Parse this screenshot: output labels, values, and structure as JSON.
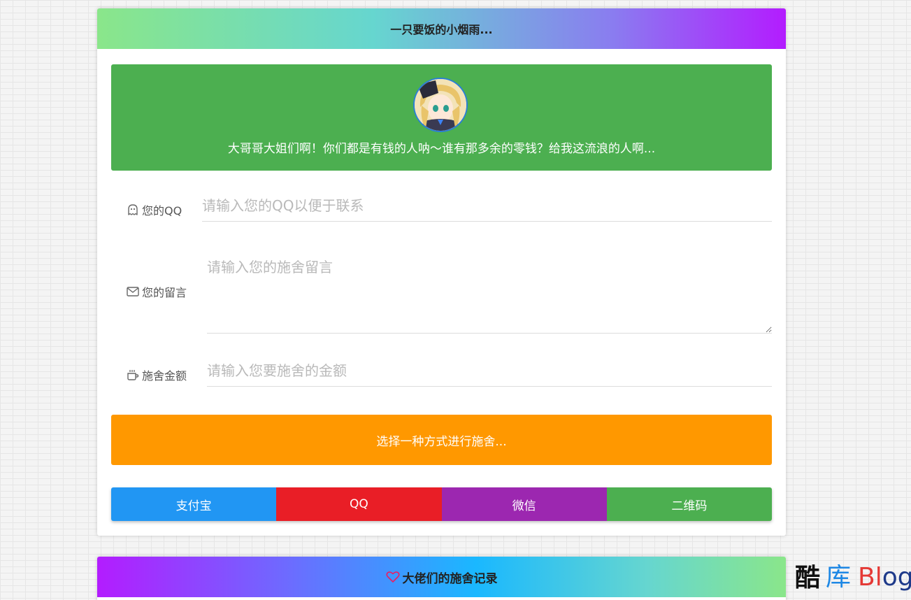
{
  "donate_card": {
    "header_title": "一只要饭的小烟雨...",
    "banner_text": "大哥哥大姐们啊！你们都是有钱的人呐～谁有那多余的零钱？给我这流浪的人啊...",
    "qq_field": {
      "icon": "ghost-icon",
      "label": "您的QQ",
      "placeholder": "请输入您的QQ以便于联系",
      "value": ""
    },
    "message_field": {
      "icon": "envelope-icon",
      "label": "您的留言",
      "placeholder": "请输入您的施舍留言",
      "value": ""
    },
    "amount_field": {
      "icon": "coffee-cup-icon",
      "label": "施舍金额",
      "placeholder": "请输入您要施舍的金额",
      "value": ""
    },
    "choose_button": "选择一种方式进行施舍...",
    "payment_methods": [
      {
        "label": "支付宝",
        "color": "#2196f3"
      },
      {
        "label": "QQ",
        "color": "#e91e26"
      },
      {
        "label": "微信",
        "color": "#9c27b0"
      },
      {
        "label": "二维码",
        "color": "#4caf50"
      }
    ]
  },
  "records_card": {
    "icon": "heart-icon",
    "header_title": "大佬们的施舍记录"
  },
  "watermark": {
    "part1": "酷",
    "part2": "库",
    "part3": "Bl",
    "part4": "og"
  },
  "colors": {
    "banner": "#4caf50",
    "choose_button": "#ff9800",
    "heart": "#e91e63"
  }
}
